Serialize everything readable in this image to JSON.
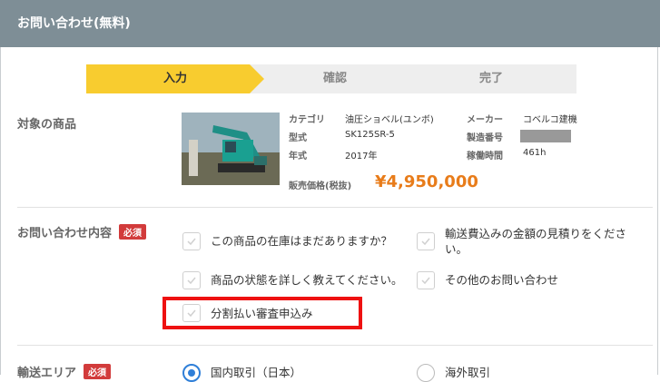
{
  "header": {
    "title": "お問い合わせ(無料)"
  },
  "steps": [
    "入力",
    "確認",
    "完了"
  ],
  "product_section": {
    "label": "対象の商品",
    "category_key": "カテゴリ",
    "category_val": "油圧ショベル(ユンボ)",
    "maker_key": "メーカー",
    "maker_val": "コベルコ建機",
    "model_key": "型式",
    "model_val": "SK125SR-5",
    "serial_key": "製造番号",
    "year_key": "年式",
    "year_val": "2017年",
    "hours_key": "稼働時間",
    "hours_val": "461h",
    "price_key": "販売価格(税抜)",
    "price_val": "¥4,950,000"
  },
  "inquiry_section": {
    "label": "お問い合わせ内容",
    "required": "必須",
    "options": [
      "この商品の在庫はまだありますか？",
      "輸送費込みの金額の見積りをください。",
      "商品の状態を詳しく教えてください。",
      "その他のお問い合わせ",
      "分割払い審査申込み"
    ]
  },
  "area_section": {
    "label": "輸送エリア",
    "required": "必須",
    "domestic": "国内取引（日本）",
    "overseas": "海外取引"
  },
  "colors": {
    "accent": "#f8cc2f",
    "header": "#7e8e96",
    "price": "#e87c1a",
    "required": "#d23b3b",
    "highlight": "#ee1111",
    "radio": "#2f7fd8"
  }
}
